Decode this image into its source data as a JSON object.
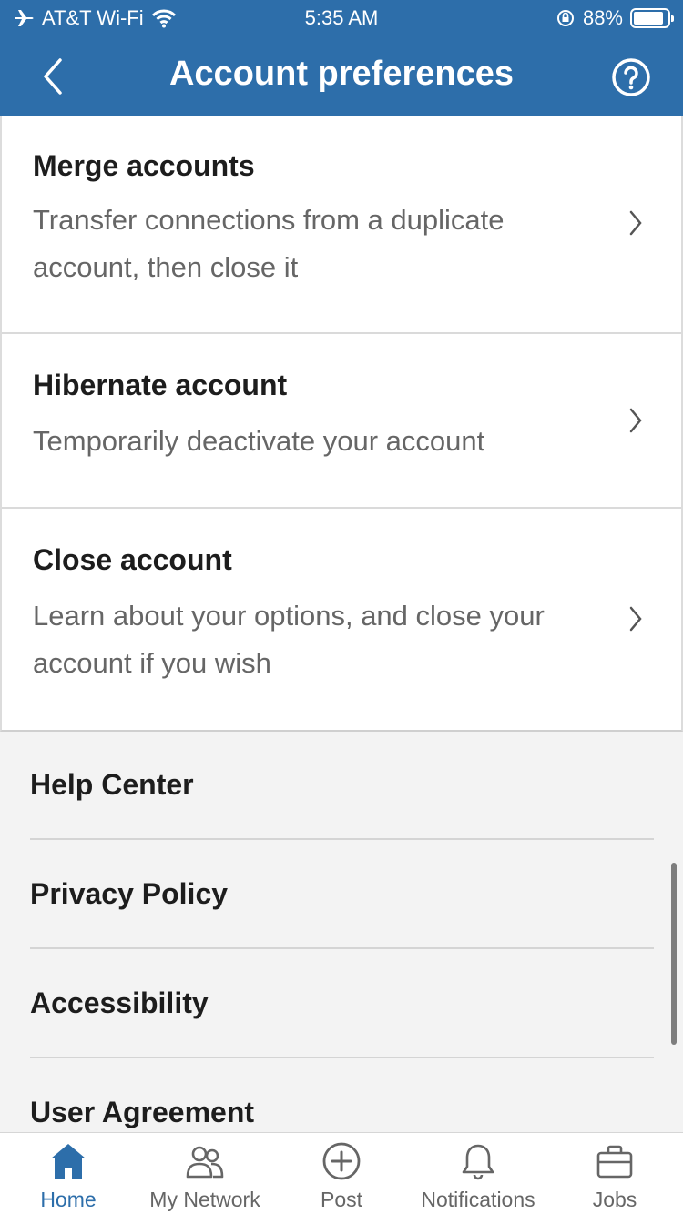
{
  "status_bar": {
    "carrier": "AT&T Wi-Fi",
    "time": "5:35 AM",
    "battery": "88%",
    "battery_level": 0.88
  },
  "header": {
    "title": "Account preferences",
    "back_icon": "chevron-left-icon",
    "help_icon": "question-circle-icon"
  },
  "preferences": [
    {
      "title": "Merge accounts",
      "desc_line1": "Transfer connections from a duplicate",
      "desc_line2": "account, then close it"
    },
    {
      "title": "Hibernate account",
      "desc_line1": "Temporarily deactivate your account",
      "desc_line2": ""
    },
    {
      "title": "Close account",
      "desc_line1": "Learn about your options, and close your",
      "desc_line2": "account if you wish"
    }
  ],
  "footer_links": [
    "Help Center",
    "Privacy Policy",
    "Accessibility",
    "User Agreement"
  ],
  "tabs": [
    {
      "label": "Home",
      "icon": "home-icon",
      "active": true
    },
    {
      "label": "My Network",
      "icon": "network-icon",
      "active": false
    },
    {
      "label": "Post",
      "icon": "plus-circle-icon",
      "active": false
    },
    {
      "label": "Notifications",
      "icon": "bell-icon",
      "active": false
    },
    {
      "label": "Jobs",
      "icon": "briefcase-icon",
      "active": false
    }
  ],
  "colors": {
    "brand": "#2d6eaa",
    "background": "#f3f3f3"
  }
}
